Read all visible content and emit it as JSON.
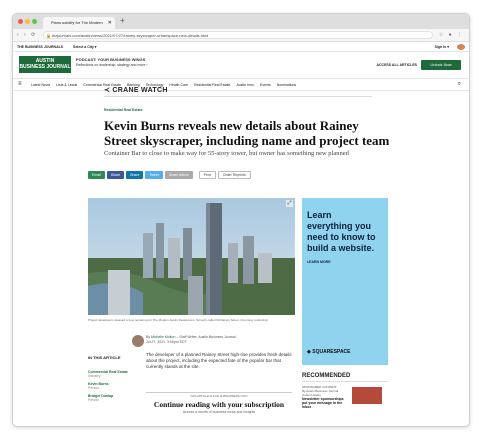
{
  "browser": {
    "tab_title": "Plans solidify for The Modern",
    "url": "bizjournals.com/austin/news/2021/07/27/rainey-skyscraper-urbanspace-new-details.html"
  },
  "top_strip": {
    "brand": "THE BUSINESS JOURNALS",
    "select_city": "Select a City ▾",
    "sign_in": "Sign In ▾"
  },
  "masthead": {
    "logo_line1": "AUSTIN",
    "logo_line2": "BUSINESS JOURNAL",
    "promo_title": "PODCAST: YOUR BUSINESS WINGS",
    "promo_sub": "Reflections on leadership, strategy and more ›",
    "access_all": "ACCESS ALL ARTICLES",
    "unlock": "Unlock Now"
  },
  "nav": {
    "items": [
      "Latest News",
      "Lists & Leads",
      "Commercial Real Estate",
      "Banking",
      "Technology",
      "Health Care",
      "Residential Real Estate",
      "Austin Inno",
      "Events",
      "Nominations"
    ]
  },
  "section": {
    "crane": "≺ CRANE WATCH",
    "kicker": "Residential Real Estate"
  },
  "article": {
    "headline": "Kevin Burns reveals new details about Rainey Street skyscraper, including name and project team",
    "dek": "Container Bar to close to make way for 55-story tower, but owner has something new planned",
    "caption": "Project developers released a new rendering for The Modern Austin Residences, formerly called 90 Rainey Street. (Courtesy rendering)",
    "byline_by": "By",
    "author": "Michelle Molton",
    "author_role": "– Staff Writer, Austin Business Journal",
    "date": "Jul 27, 2021, 3:50pm EDT",
    "body": "The developer of a planned Rainey Street high-rise provides fresh details about the project, including the expected fate of the popular bar that currently stands at the site.",
    "sub_note": "THIS ARTICLE IS FOR SUBSCRIBERS ONLY",
    "continue": "Continue reading with your subscription",
    "access_more": "Access a month of business news and insights"
  },
  "share": {
    "email": "Email",
    "share": "Share",
    "share2": "Share",
    "tweet": "Tweet",
    "share_article": "Share Article",
    "print": "Print",
    "reprints": "Order Reprints"
  },
  "in_this_article": {
    "title": "IN THIS ARTICLE",
    "items": [
      {
        "name": "Commercial Real Estate",
        "type": "Industry"
      },
      {
        "name": "Kevin Burns",
        "type": "Person"
      },
      {
        "name": "Bridget Dunlap",
        "type": "Person"
      }
    ]
  },
  "ad": {
    "headline": "Learn everything you need to know to build a website.",
    "learn_more": "LEARN MORE",
    "brand": "SQUARESPACE",
    "colors": {
      "bg": "#8fd3ef",
      "text": "#0f1f3a"
    }
  },
  "recommended": {
    "title": "RECOMMENDED",
    "sponsor": "SPONSORED CONTENT",
    "by": "By Austin Business Journal Custom Audio",
    "headline": "Newsletter sponsorships put your message in the inbox"
  },
  "colors": {
    "brand_green": "#1d6b3a"
  }
}
